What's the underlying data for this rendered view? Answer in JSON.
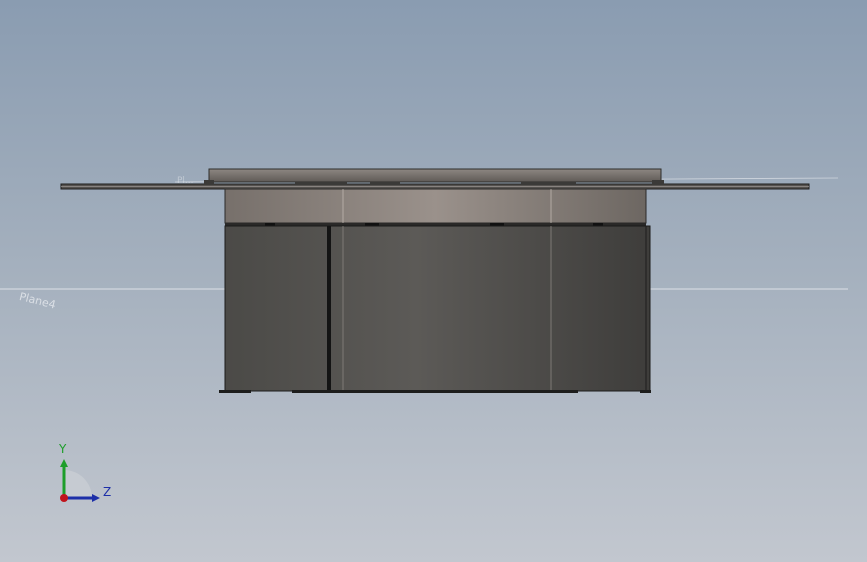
{
  "viewport": {
    "background_top": "#8a9cb1",
    "background_bottom": "#c2c7cf"
  },
  "planes": {
    "plane4_label": "Plane4",
    "top_plane_label": "Pl..."
  },
  "triad": {
    "y_label": "Y",
    "z_label": "Z",
    "y_color": "#1d9e2a",
    "z_color": "#1d2fa8",
    "x_color": "#c0141c"
  }
}
